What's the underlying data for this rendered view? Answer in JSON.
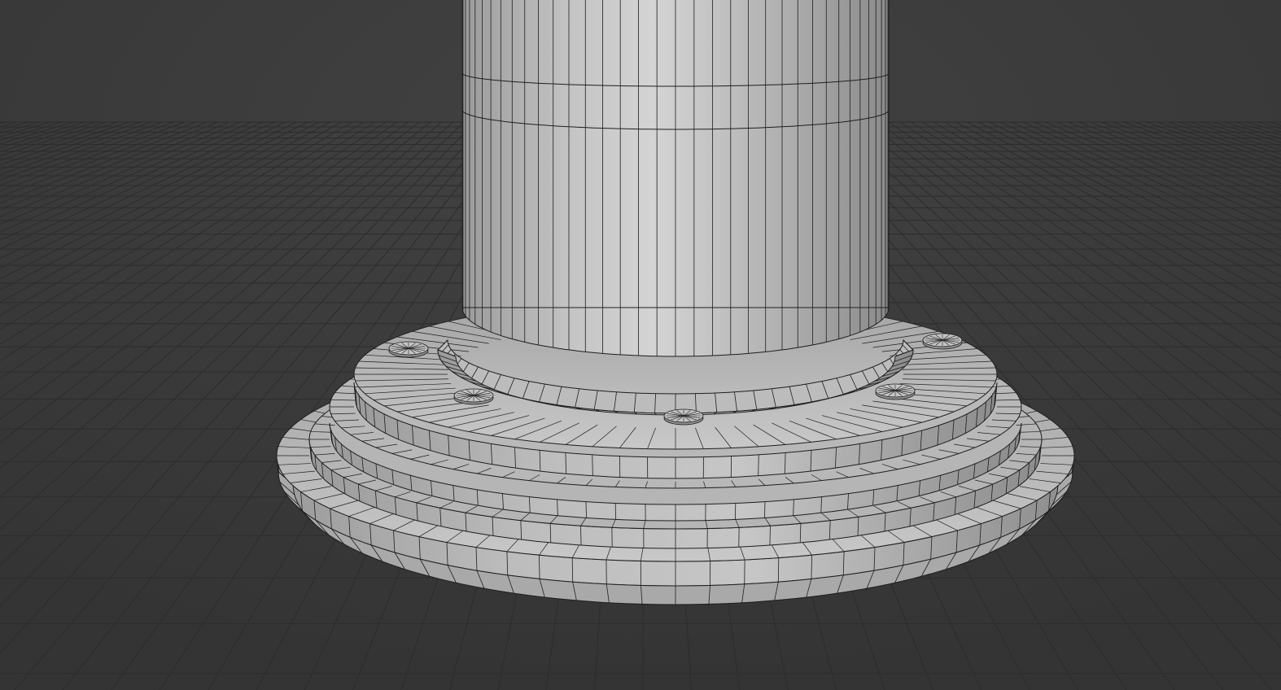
{
  "viewport": {
    "object_type": "mesh",
    "shading_mode": "solid",
    "overlay": "wireframe",
    "show_floor_grid": true
  },
  "colors": {
    "background": "#3a3a3a",
    "grid_line": "#2c2c2c",
    "mesh_light": "#d6d6d6",
    "mesh_mid": "#a8a8a8",
    "mesh_dark": "#7b7b7b",
    "wire": "#1e1e1e"
  },
  "icons": {
    "bolt": "bolt-head"
  },
  "mesh": {
    "shaft_segments": 36,
    "base_segments": 36,
    "bolt_count": 6
  }
}
